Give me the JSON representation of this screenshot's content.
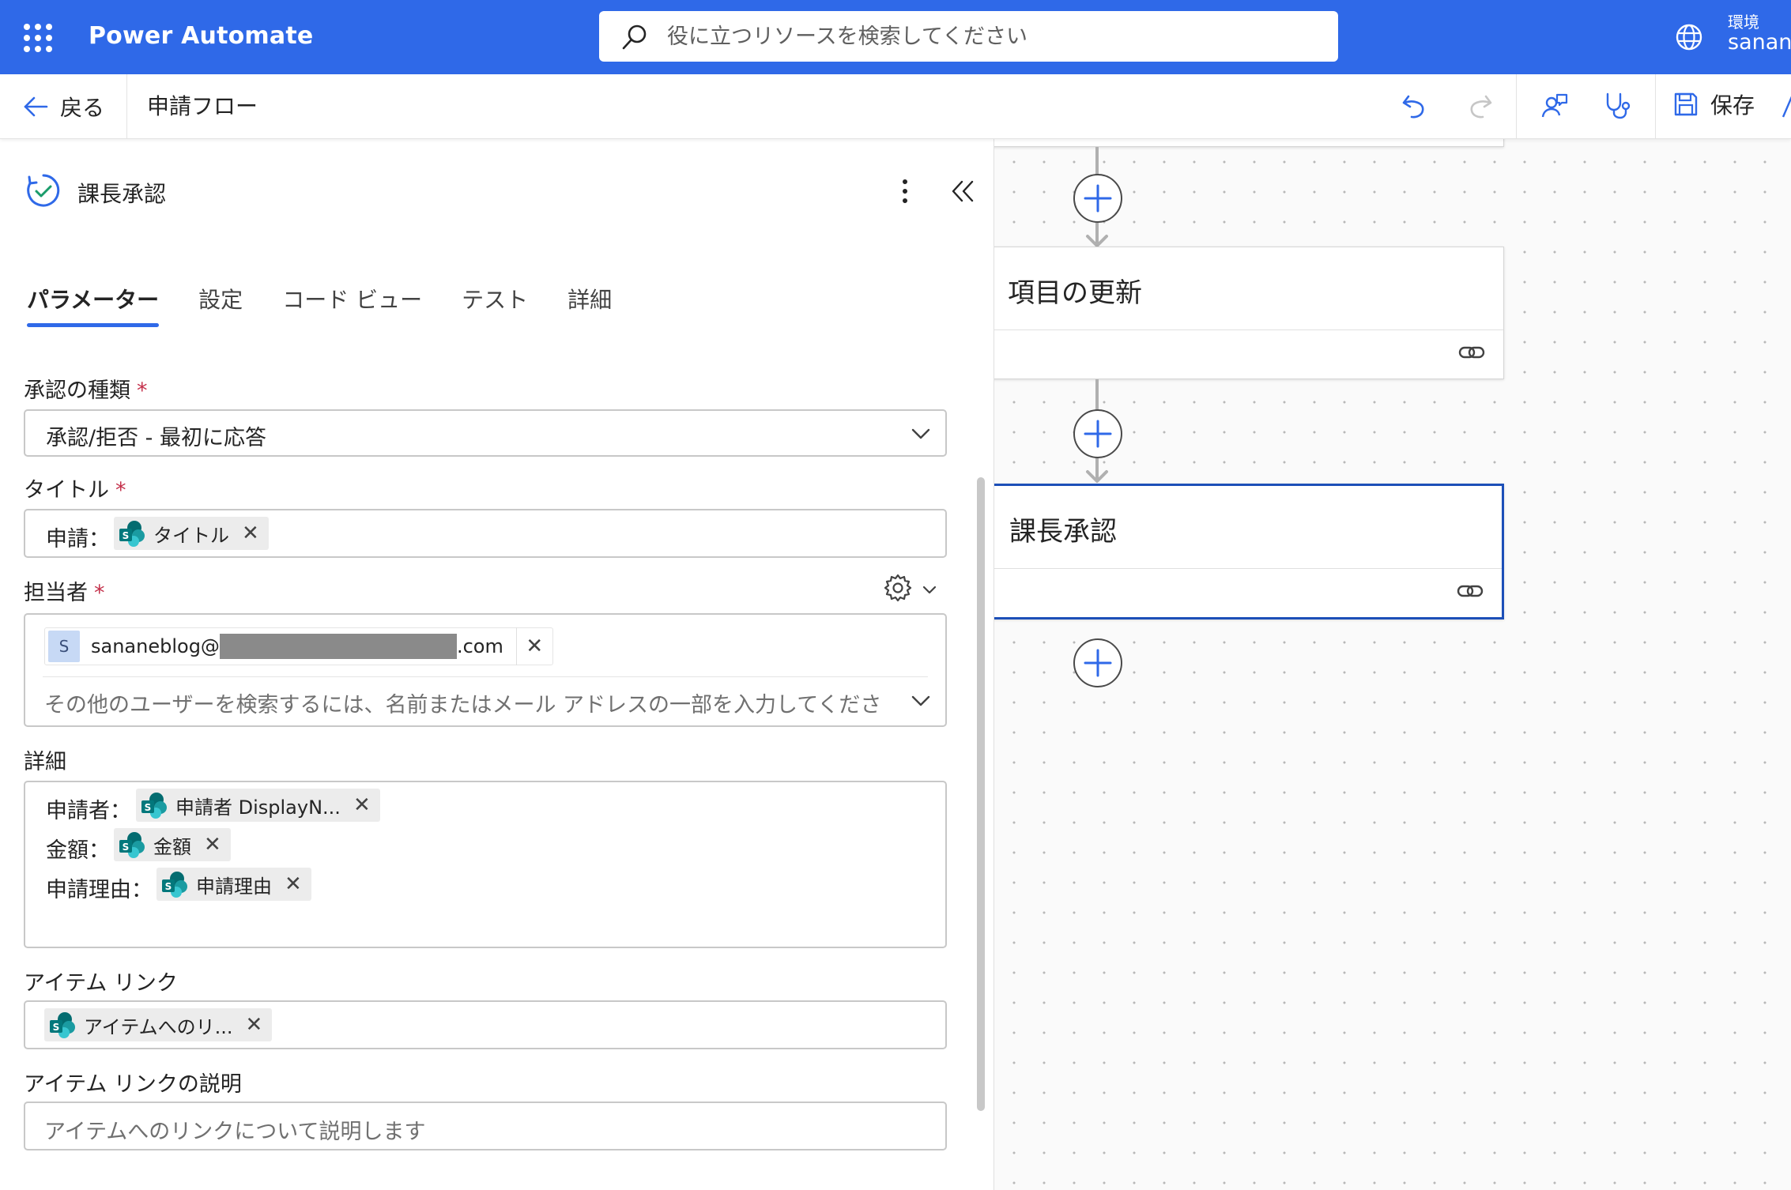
{
  "app": {
    "name": "Power Automate"
  },
  "search": {
    "placeholder": "役に立つリソースを検索してください"
  },
  "environment": {
    "label": "環境",
    "name": "sanan"
  },
  "toolbar": {
    "back_label": "戻る",
    "flow_name": "申請フロー",
    "save_label": "保存"
  },
  "panel": {
    "title": "課長承認",
    "tabs": [
      {
        "label": "パラメーター",
        "active": true
      },
      {
        "label": "設定"
      },
      {
        "label": "コード ビュー"
      },
      {
        "label": "テスト"
      },
      {
        "label": "詳細"
      }
    ],
    "fields": {
      "approval_type": {
        "label": "承認の種類",
        "required_mark": "*",
        "value": "承認/拒否 - 最初に応答"
      },
      "title": {
        "label": "タイトル",
        "required_mark": "*",
        "prefix": "申請：",
        "token": "タイトル"
      },
      "assignee": {
        "label": "担当者",
        "required_mark": "*",
        "avatar_letter": "S",
        "email_user": "sananeblog@",
        "email_domain_suffix": ".com",
        "placeholder": "その他のユーザーを検索するには、名前またはメール アドレスの一部を入力してくださ"
      },
      "details": {
        "label": "詳細",
        "lines": [
          {
            "prefix": "申請者：",
            "token": "申請者 DisplayN..."
          },
          {
            "prefix": "金額：",
            "token": "金額"
          },
          {
            "prefix": "申請理由：",
            "token": "申請理由"
          }
        ]
      },
      "item_link": {
        "label": "アイテム リンク",
        "token": "アイテムへのリ..."
      },
      "item_link_description": {
        "label": "アイテム リンクの説明",
        "placeholder": "アイテムへのリンクについて説明します"
      }
    }
  },
  "canvas": {
    "cards": [
      {
        "title": "項目の更新",
        "selected": false
      },
      {
        "title": "課長承認",
        "selected": true
      }
    ]
  },
  "colors": {
    "brand": "#2f69e8",
    "selected_border": "#1c4fb8",
    "required": "#c4314b"
  }
}
